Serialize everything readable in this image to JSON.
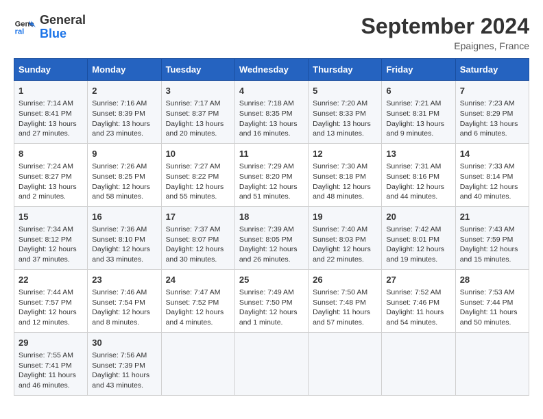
{
  "header": {
    "logo_line1": "General",
    "logo_line2": "Blue",
    "month": "September 2024",
    "location": "Epaignes, France"
  },
  "days_of_week": [
    "Sunday",
    "Monday",
    "Tuesday",
    "Wednesday",
    "Thursday",
    "Friday",
    "Saturday"
  ],
  "weeks": [
    [
      {
        "day": "1",
        "lines": [
          "Sunrise: 7:14 AM",
          "Sunset: 8:41 PM",
          "Daylight: 13 hours",
          "and 27 minutes."
        ]
      },
      {
        "day": "2",
        "lines": [
          "Sunrise: 7:16 AM",
          "Sunset: 8:39 PM",
          "Daylight: 13 hours",
          "and 23 minutes."
        ]
      },
      {
        "day": "3",
        "lines": [
          "Sunrise: 7:17 AM",
          "Sunset: 8:37 PM",
          "Daylight: 13 hours",
          "and 20 minutes."
        ]
      },
      {
        "day": "4",
        "lines": [
          "Sunrise: 7:18 AM",
          "Sunset: 8:35 PM",
          "Daylight: 13 hours",
          "and 16 minutes."
        ]
      },
      {
        "day": "5",
        "lines": [
          "Sunrise: 7:20 AM",
          "Sunset: 8:33 PM",
          "Daylight: 13 hours",
          "and 13 minutes."
        ]
      },
      {
        "day": "6",
        "lines": [
          "Sunrise: 7:21 AM",
          "Sunset: 8:31 PM",
          "Daylight: 13 hours",
          "and 9 minutes."
        ]
      },
      {
        "day": "7",
        "lines": [
          "Sunrise: 7:23 AM",
          "Sunset: 8:29 PM",
          "Daylight: 13 hours",
          "and 6 minutes."
        ]
      }
    ],
    [
      {
        "day": "8",
        "lines": [
          "Sunrise: 7:24 AM",
          "Sunset: 8:27 PM",
          "Daylight: 13 hours",
          "and 2 minutes."
        ]
      },
      {
        "day": "9",
        "lines": [
          "Sunrise: 7:26 AM",
          "Sunset: 8:25 PM",
          "Daylight: 12 hours",
          "and 58 minutes."
        ]
      },
      {
        "day": "10",
        "lines": [
          "Sunrise: 7:27 AM",
          "Sunset: 8:22 PM",
          "Daylight: 12 hours",
          "and 55 minutes."
        ]
      },
      {
        "day": "11",
        "lines": [
          "Sunrise: 7:29 AM",
          "Sunset: 8:20 PM",
          "Daylight: 12 hours",
          "and 51 minutes."
        ]
      },
      {
        "day": "12",
        "lines": [
          "Sunrise: 7:30 AM",
          "Sunset: 8:18 PM",
          "Daylight: 12 hours",
          "and 48 minutes."
        ]
      },
      {
        "day": "13",
        "lines": [
          "Sunrise: 7:31 AM",
          "Sunset: 8:16 PM",
          "Daylight: 12 hours",
          "and 44 minutes."
        ]
      },
      {
        "day": "14",
        "lines": [
          "Sunrise: 7:33 AM",
          "Sunset: 8:14 PM",
          "Daylight: 12 hours",
          "and 40 minutes."
        ]
      }
    ],
    [
      {
        "day": "15",
        "lines": [
          "Sunrise: 7:34 AM",
          "Sunset: 8:12 PM",
          "Daylight: 12 hours",
          "and 37 minutes."
        ]
      },
      {
        "day": "16",
        "lines": [
          "Sunrise: 7:36 AM",
          "Sunset: 8:10 PM",
          "Daylight: 12 hours",
          "and 33 minutes."
        ]
      },
      {
        "day": "17",
        "lines": [
          "Sunrise: 7:37 AM",
          "Sunset: 8:07 PM",
          "Daylight: 12 hours",
          "and 30 minutes."
        ]
      },
      {
        "day": "18",
        "lines": [
          "Sunrise: 7:39 AM",
          "Sunset: 8:05 PM",
          "Daylight: 12 hours",
          "and 26 minutes."
        ]
      },
      {
        "day": "19",
        "lines": [
          "Sunrise: 7:40 AM",
          "Sunset: 8:03 PM",
          "Daylight: 12 hours",
          "and 22 minutes."
        ]
      },
      {
        "day": "20",
        "lines": [
          "Sunrise: 7:42 AM",
          "Sunset: 8:01 PM",
          "Daylight: 12 hours",
          "and 19 minutes."
        ]
      },
      {
        "day": "21",
        "lines": [
          "Sunrise: 7:43 AM",
          "Sunset: 7:59 PM",
          "Daylight: 12 hours",
          "and 15 minutes."
        ]
      }
    ],
    [
      {
        "day": "22",
        "lines": [
          "Sunrise: 7:44 AM",
          "Sunset: 7:57 PM",
          "Daylight: 12 hours",
          "and 12 minutes."
        ]
      },
      {
        "day": "23",
        "lines": [
          "Sunrise: 7:46 AM",
          "Sunset: 7:54 PM",
          "Daylight: 12 hours",
          "and 8 minutes."
        ]
      },
      {
        "day": "24",
        "lines": [
          "Sunrise: 7:47 AM",
          "Sunset: 7:52 PM",
          "Daylight: 12 hours",
          "and 4 minutes."
        ]
      },
      {
        "day": "25",
        "lines": [
          "Sunrise: 7:49 AM",
          "Sunset: 7:50 PM",
          "Daylight: 12 hours",
          "and 1 minute."
        ]
      },
      {
        "day": "26",
        "lines": [
          "Sunrise: 7:50 AM",
          "Sunset: 7:48 PM",
          "Daylight: 11 hours",
          "and 57 minutes."
        ]
      },
      {
        "day": "27",
        "lines": [
          "Sunrise: 7:52 AM",
          "Sunset: 7:46 PM",
          "Daylight: 11 hours",
          "and 54 minutes."
        ]
      },
      {
        "day": "28",
        "lines": [
          "Sunrise: 7:53 AM",
          "Sunset: 7:44 PM",
          "Daylight: 11 hours",
          "and 50 minutes."
        ]
      }
    ],
    [
      {
        "day": "29",
        "lines": [
          "Sunrise: 7:55 AM",
          "Sunset: 7:41 PM",
          "Daylight: 11 hours",
          "and 46 minutes."
        ]
      },
      {
        "day": "30",
        "lines": [
          "Sunrise: 7:56 AM",
          "Sunset: 7:39 PM",
          "Daylight: 11 hours",
          "and 43 minutes."
        ]
      },
      null,
      null,
      null,
      null,
      null
    ]
  ]
}
